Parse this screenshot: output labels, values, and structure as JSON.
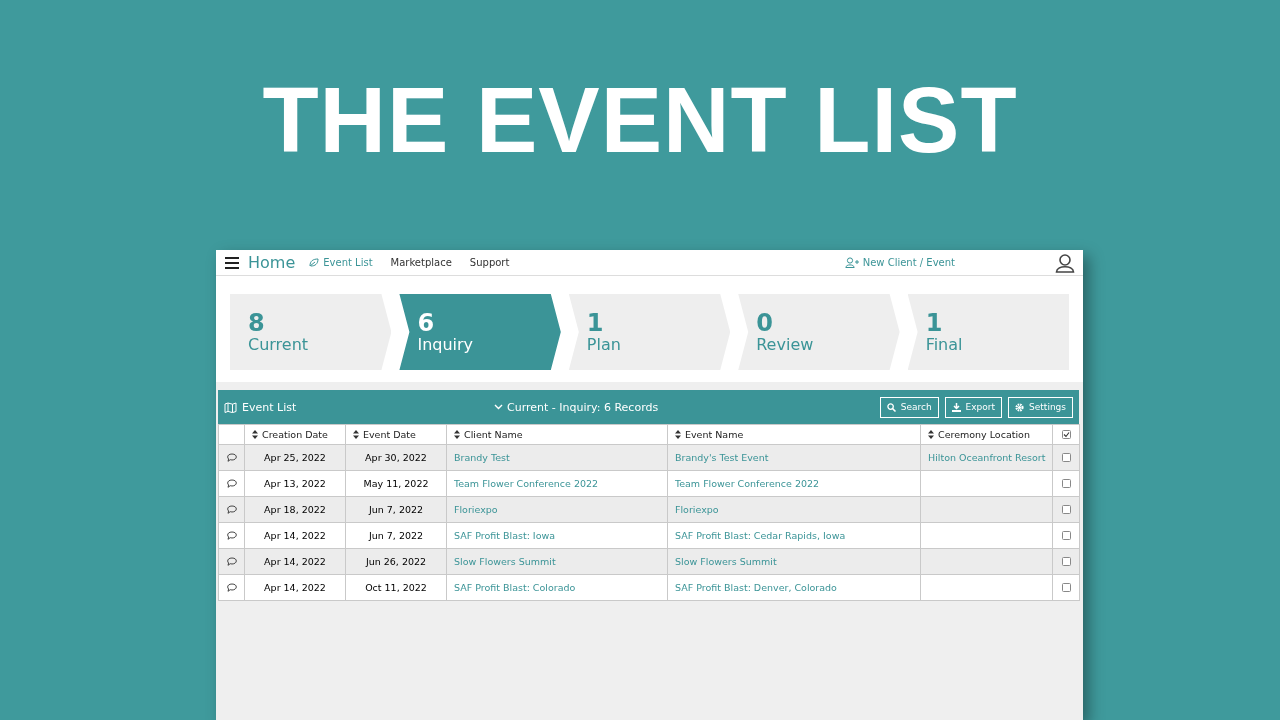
{
  "headline": "THE EVENT LIST",
  "nav": {
    "brand": "Home",
    "items": [
      {
        "label": "Event List",
        "selected": true
      },
      {
        "label": "Marketplace",
        "selected": false
      },
      {
        "label": "Support",
        "selected": false
      }
    ],
    "new_button": "New Client / Event"
  },
  "stages": [
    {
      "count": "8",
      "label": "Current",
      "selected": false
    },
    {
      "count": "6",
      "label": "Inquiry",
      "selected": true
    },
    {
      "count": "1",
      "label": "Plan",
      "selected": false
    },
    {
      "count": "0",
      "label": "Review",
      "selected": false
    },
    {
      "count": "1",
      "label": "Final",
      "selected": false
    }
  ],
  "panel": {
    "title": "Event List",
    "filter": "Current - Inquiry: 6 Records",
    "buttons": [
      "Search",
      "Export",
      "Settings"
    ]
  },
  "table": {
    "columns": [
      "Creation Date",
      "Event Date",
      "Client Name",
      "Event Name",
      "Ceremony Location"
    ],
    "header_checked": true,
    "rows": [
      {
        "creation_date": "Apr 25, 2022",
        "event_date": "Apr 30, 2022",
        "client_name": "Brandy Test",
        "event_name": "Brandy's Test Event",
        "ceremony_location": "Hilton Oceanfront Resort",
        "checked": false
      },
      {
        "creation_date": "Apr 13, 2022",
        "event_date": "May 11, 2022",
        "client_name": "Team Flower Conference 2022",
        "event_name": "Team Flower Conference 2022",
        "checked": false
      },
      {
        "creation_date": "Apr 18, 2022",
        "event_date": "Jun 7, 2022",
        "client_name": "Floriexpo",
        "event_name": "Floriexpo",
        "checked": false
      },
      {
        "creation_date": "Apr 14, 2022",
        "event_date": "Jun 7, 2022",
        "client_name": "SAF Profit Blast: Iowa",
        "event_name": "SAF Profit Blast: Cedar Rapids, Iowa",
        "checked": false
      },
      {
        "creation_date": "Apr 14, 2022",
        "event_date": "Jun 26, 2022",
        "client_name": "Slow Flowers Summit",
        "event_name": "Slow Flowers Summit",
        "checked": false
      },
      {
        "creation_date": "Apr 14, 2022",
        "event_date": "Oct 11, 2022",
        "client_name": "SAF Profit Blast: Colorado",
        "event_name": "SAF Profit Blast: Denver, Colorado",
        "checked": false
      }
    ]
  }
}
